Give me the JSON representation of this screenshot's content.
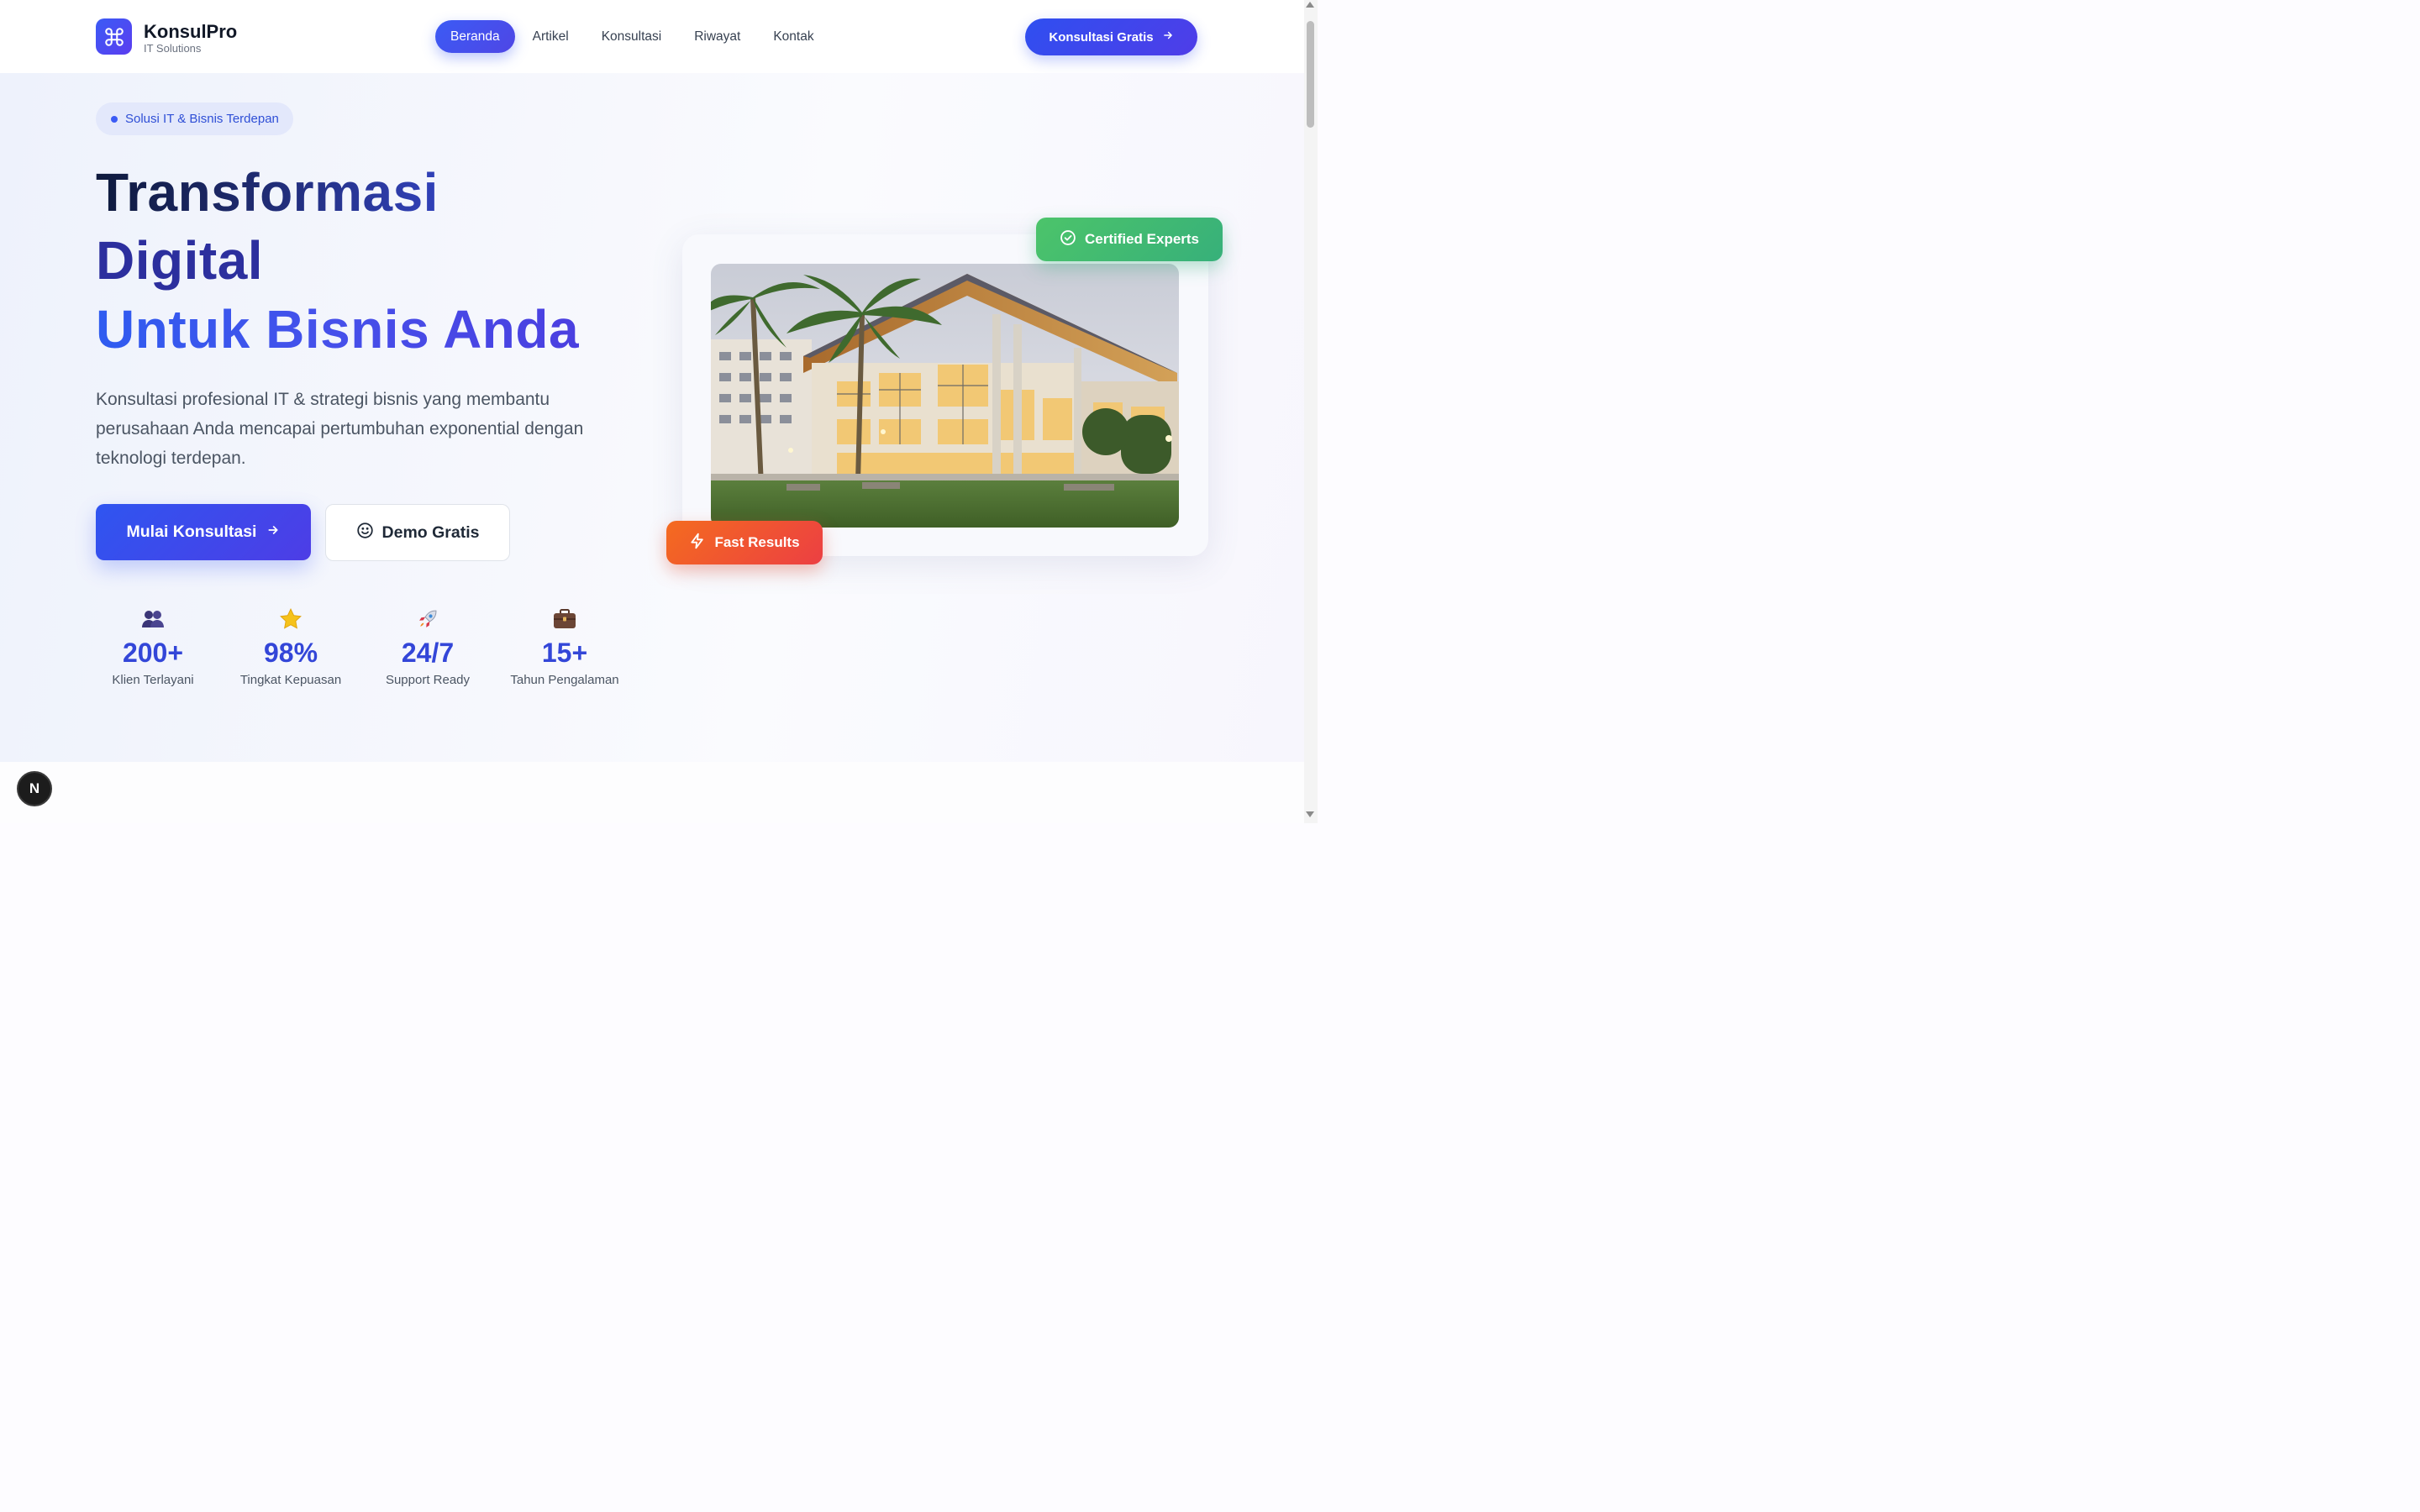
{
  "brand": {
    "name": "KonsulPro",
    "tagline": "IT Solutions"
  },
  "nav": {
    "items": [
      {
        "label": "Beranda",
        "active": true
      },
      {
        "label": "Artikel",
        "active": false
      },
      {
        "label": "Konsultasi",
        "active": false
      },
      {
        "label": "Riwayat",
        "active": false
      },
      {
        "label": "Kontak",
        "active": false
      }
    ],
    "cta_label": "Konsultasi Gratis",
    "cta_icon": "arrow-right-icon"
  },
  "hero": {
    "pill": "Solusi IT & Bisnis Terdepan",
    "title_line1": "Transformasi",
    "title_line2": "Digital",
    "title_line3": "Untuk Bisnis Anda",
    "lead": "Konsultasi profesional IT & strategi bisnis yang membantu perusahaan Anda mencapai pertumbuhan exponential dengan teknologi terdepan.",
    "primary_button": "Mulai Konsultasi",
    "secondary_button": "Demo Gratis"
  },
  "stats": [
    {
      "icon": "people-icon",
      "value": "200+",
      "label": "Klien Terlayani"
    },
    {
      "icon": "star-icon",
      "value": "98%",
      "label": "Tingkat Kepuasan"
    },
    {
      "icon": "rocket-icon",
      "value": "24/7",
      "label": "Support Ready"
    },
    {
      "icon": "briefcase-icon",
      "value": "15+",
      "label": "Tahun Pengalaman"
    }
  ],
  "badges": {
    "certified": "Certified Experts",
    "fast": "Fast Results"
  },
  "dev_indicator": "N",
  "colors": {
    "primary": "#3b5bf5",
    "accent_green": "#4cc46a",
    "accent_orange": "#f46b1f",
    "stat_value": "#3346d8"
  }
}
